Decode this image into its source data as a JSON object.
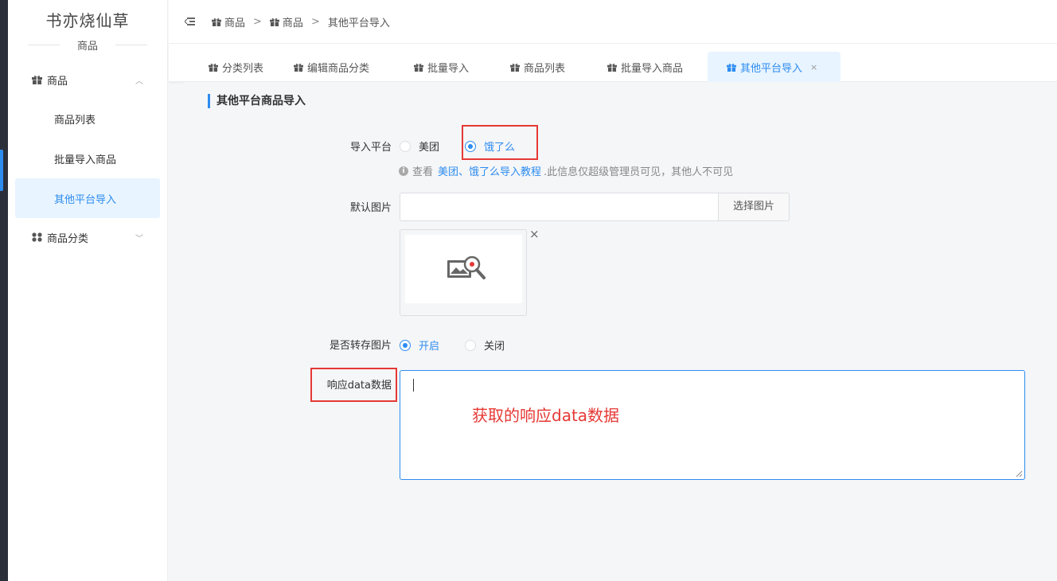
{
  "brand": {
    "name": "书亦烧仙草",
    "module": "商品"
  },
  "sidebar": {
    "groups": [
      {
        "label": "商品",
        "icon": "gift-icon",
        "arrow": "^"
      },
      {
        "label": "商品分类",
        "icon": "grid-icon",
        "arrow": "v"
      }
    ],
    "items": [
      {
        "label": "商品列表"
      },
      {
        "label": "批量导入商品"
      },
      {
        "label": "其他平台导入"
      }
    ]
  },
  "header": {
    "breadcrumb": [
      "商品",
      "商品",
      "其他平台导入"
    ],
    "separator": ">"
  },
  "tabs": [
    {
      "label": "分类列表"
    },
    {
      "label": "编辑商品分类"
    },
    {
      "label": "批量导入"
    },
    {
      "label": "商品列表"
    },
    {
      "label": "批量导入商品"
    },
    {
      "label": "其他平台导入",
      "close": "×"
    }
  ],
  "form": {
    "section_title": "其他平台商品导入",
    "platform": {
      "label": "导入平台",
      "options": [
        "美团",
        "饿了么"
      ],
      "selected": "饿了么"
    },
    "hint": {
      "prefix": "查看",
      "link": "美团、饿了么导入教程",
      "suffix": ".此信息仅超级管理员可见，其他人不可见"
    },
    "default_image": {
      "label": "默认图片",
      "value": "",
      "button": "选择图片",
      "remove": "×"
    },
    "save_image": {
      "label": "是否转存图片",
      "options": [
        "开启",
        "关闭"
      ],
      "selected": "开启"
    },
    "response_data": {
      "label": "响应data数据",
      "value": "",
      "annotation": "获取的响应data数据"
    }
  },
  "colors": {
    "accent": "#2d8cf0",
    "annotation": "#e53935"
  }
}
